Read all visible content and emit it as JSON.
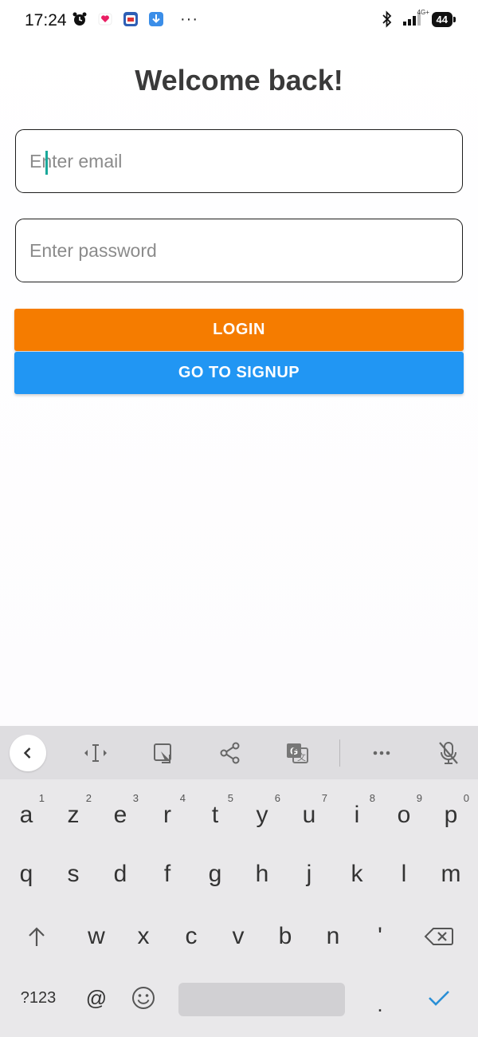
{
  "status_bar": {
    "time": "17:24",
    "left_icons": [
      "alarm-clock-icon",
      "heart-notification-icon",
      "calendar-app-icon",
      "download-app-icon"
    ],
    "more": "···",
    "network": "4G+",
    "battery": "44"
  },
  "login": {
    "title": "Welcome back!",
    "email_placeholder": "Enter email",
    "password_placeholder": "Enter password",
    "login_label": "LOGIN",
    "signup_label": "GO TO SIGNUP",
    "colors": {
      "login": "#f57c00",
      "signup": "#2196f3",
      "caret": "#19a89a"
    }
  },
  "keyboard": {
    "toolbar": [
      "back-chevron-icon",
      "cursor-move-icon",
      "clipboard-icon",
      "share-icon",
      "translate-icon",
      "more-icon",
      "mic-off-icon"
    ],
    "row1": [
      {
        "k": "a",
        "n": "1"
      },
      {
        "k": "z",
        "n": "2"
      },
      {
        "k": "e",
        "n": "3"
      },
      {
        "k": "r",
        "n": "4"
      },
      {
        "k": "t",
        "n": "5"
      },
      {
        "k": "y",
        "n": "6"
      },
      {
        "k": "u",
        "n": "7"
      },
      {
        "k": "i",
        "n": "8"
      },
      {
        "k": "o",
        "n": "9"
      },
      {
        "k": "p",
        "n": "0"
      }
    ],
    "row2": [
      "q",
      "s",
      "d",
      "f",
      "g",
      "h",
      "j",
      "k",
      "l",
      "m"
    ],
    "row3": [
      "w",
      "x",
      "c",
      "v",
      "b",
      "n",
      "'"
    ],
    "bottom": {
      "symbols": "?123",
      "at": "@",
      "period": "."
    }
  }
}
